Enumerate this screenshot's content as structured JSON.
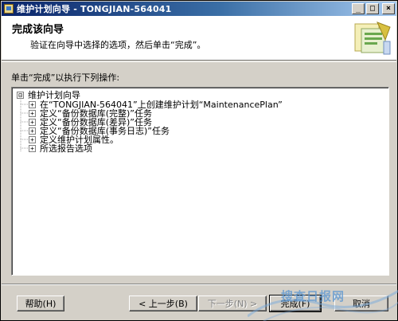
{
  "window": {
    "title": "维护计划向导 - TONGJIAN-564041",
    "buttons": {
      "minimize": "_",
      "maximize": "□",
      "close": "×"
    }
  },
  "header": {
    "title": "完成该向导",
    "description": "验证在向导中选择的选项，然后单击“完成”。",
    "art_icon": "wizard-illustration-icon"
  },
  "instructions": "单击“完成”以执行下列操作:",
  "tree": {
    "root": {
      "expander": "⊟",
      "label": "维护计划向导"
    },
    "items": [
      {
        "expander": "+",
        "label": "在“TONGJIAN-564041”上创建维护计划“MaintenancePlan”"
      },
      {
        "expander": "+",
        "label": "定义“备份数据库(完整)”任务"
      },
      {
        "expander": "+",
        "label": "定义“备份数据库(差异)”任务"
      },
      {
        "expander": "+",
        "label": "定义“备份数据库(事务日志)”任务"
      },
      {
        "expander": "+",
        "label": "定义维护计划属性。"
      },
      {
        "expander": "+",
        "label": "所选报告选项"
      }
    ]
  },
  "buttons": {
    "help": "帮助(H)",
    "back": "< 上一步(B)",
    "next": "下一步(N) >",
    "finish": "完成(F)",
    "cancel": "取消"
  },
  "watermark": {
    "text": "搜查日报网"
  },
  "colors": {
    "titlebar_start": "#0a246a",
    "titlebar_end": "#a6caf0",
    "face": "#d4d0c8"
  }
}
